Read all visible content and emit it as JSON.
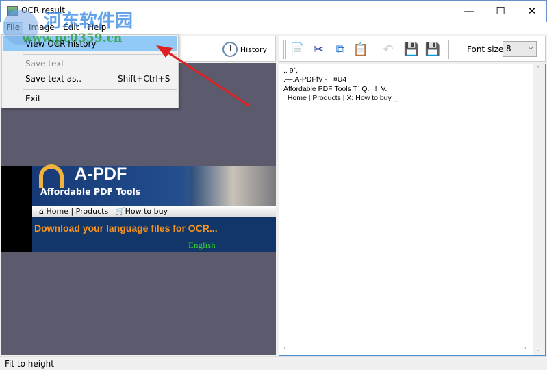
{
  "window": {
    "title": "OCR result",
    "minimize": "—",
    "maximize": "☐",
    "close": "✕"
  },
  "menubar": [
    "File",
    "Image",
    "Edit",
    "Help"
  ],
  "file_menu": {
    "items": [
      {
        "label": "View OCR history",
        "shortcut": "",
        "state": "highlighted"
      },
      {
        "label": "Save text",
        "shortcut": "",
        "state": "disabled"
      },
      {
        "label": "Save text as..",
        "shortcut": "Shift+Ctrl+S",
        "state": "normal"
      },
      {
        "label": "Exit",
        "shortcut": "",
        "state": "normal"
      }
    ]
  },
  "left_toolbar": {
    "history_label": "History"
  },
  "image": {
    "logo": "A-PDF",
    "tagline": "Affordable PDF Tools",
    "nav": {
      "home": "Home",
      "products": "Products",
      "buy": "How to buy"
    },
    "headline": "Download your language files for OCR...",
    "language": "English"
  },
  "right_toolbar": {
    "icons": [
      "text-document-icon",
      "cut-icon",
      "copy-icon",
      "paste-icon",
      "undo-icon",
      "save-icon",
      "save-as-icon"
    ],
    "font_size_label": "Font size:",
    "font_size_value": "8"
  },
  "ocr_text": ",. 9`,\n.—.A-PDFfV -   ¤U4\nAffordable PDF Tools T` Q. i !  V.\n  Home | Products | X: How to buy _",
  "status": {
    "text": "Fit to height"
  },
  "watermark": {
    "cn": "河东软件园",
    "url": "www.pc0359.cn"
  },
  "colors": {
    "menu_highlight": "#91c9f7",
    "image_bg": "#5b5b6d",
    "arrow": "#e02020",
    "headline": "#f7941d",
    "language": "#33cc33"
  }
}
